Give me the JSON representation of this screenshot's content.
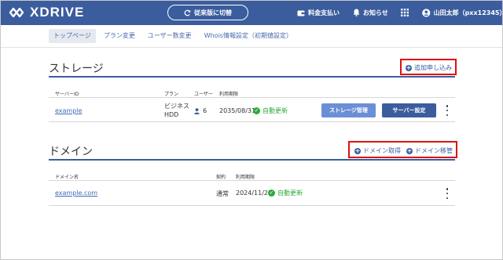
{
  "header": {
    "logo_text": "XDRIVE",
    "switch_label": "従来版に切替",
    "payment_label": "料金支払い",
    "notice_label": "お知らせ",
    "user_label": "山田太郎（pxx12345）"
  },
  "tabs": [
    {
      "label": "トップページ",
      "active": true
    },
    {
      "label": "プラン変更",
      "active": false
    },
    {
      "label": "ユーザー数変更",
      "active": false
    },
    {
      "label": "Whois情報設定（初期値設定）",
      "active": false
    }
  ],
  "storage": {
    "title": "ストレージ",
    "add_label": "追加申し込み",
    "columns": {
      "server_id": "サーバーID",
      "plan": "プラン",
      "users": "ユーザー",
      "expiry": "利用期限"
    },
    "rows": [
      {
        "server_id": "example",
        "plan_line1": "ビジネス",
        "plan_line2": "HDD",
        "users": "6",
        "expiry": "2035/08/31",
        "status": "自動更新",
        "storage_btn": "ストレージ管理",
        "server_btn": "サーバー設定"
      }
    ]
  },
  "domain": {
    "title": "ドメイン",
    "acquire_label": "ドメイン取得",
    "transfer_label": "ドメイン移管",
    "columns": {
      "name": "ドメイン名",
      "contract": "契約",
      "expiry": "利用期限"
    },
    "rows": [
      {
        "name": "example.com",
        "contract": "通常",
        "expiry": "2024/11/23",
        "status": "自動更新"
      }
    ]
  },
  "colors": {
    "brand": "#3b5d9e",
    "accent_red": "#e01010",
    "status_green": "#2eaa3a",
    "btn_light": "#6b8fd6",
    "btn_dark": "#3b5d9e"
  }
}
